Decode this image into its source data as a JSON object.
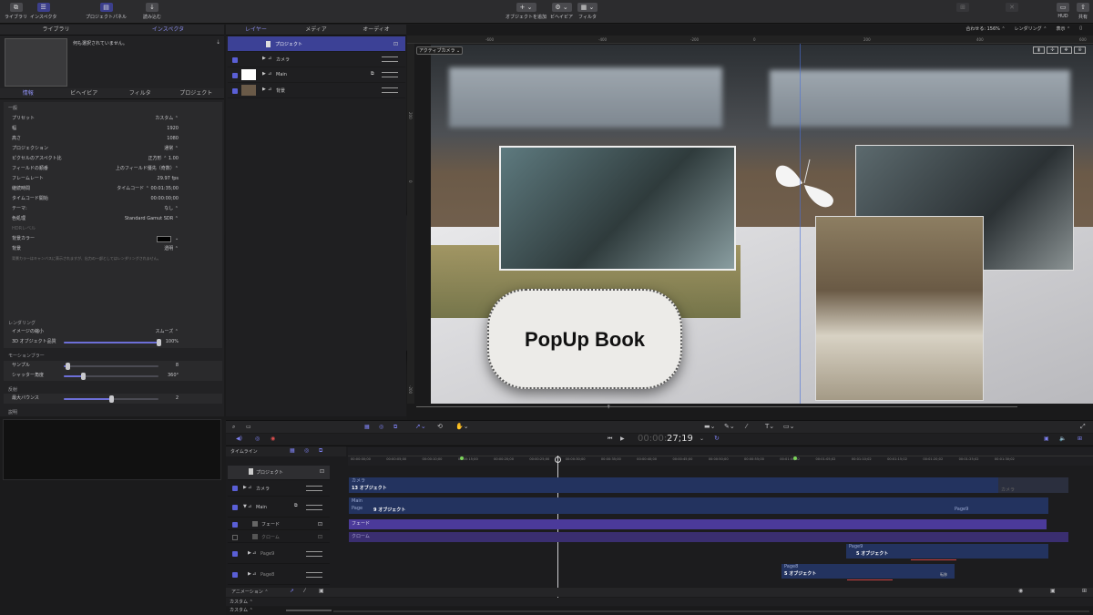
{
  "toolbar": {
    "library": "ライブラリ",
    "inspector": "インスペクタ",
    "project_panel": "プロジェクトパネル",
    "import": "読み込む",
    "add_object": "オブジェクトを追加",
    "behavior": "ビヘイビア",
    "filter": "フィルタ",
    "hud": "HUD",
    "share": "共有"
  },
  "left_tabs": [
    "ライブラリ",
    "インスペクタ"
  ],
  "preview_text": "何も選択されていません。",
  "inspector_tabs": [
    "情報",
    "ビヘイビア",
    "フィルタ",
    "プロジェクト"
  ],
  "general": {
    "section": "一般",
    "rows": [
      {
        "label": "プリセット",
        "value": "カスタム ⌃"
      },
      {
        "label": "幅",
        "value": "1920"
      },
      {
        "label": "高さ",
        "value": "1080"
      },
      {
        "label": "プロジェクション",
        "value": "通常 ⌃"
      },
      {
        "label": "ピクセルのアスペクト比",
        "value": "正方形 ⌃    1.00"
      },
      {
        "label": "フィールドの順番",
        "value": "上のフィールド優先（奇数）⌃"
      },
      {
        "label": "フレームレート",
        "value": "29.97 fps"
      },
      {
        "label": "継続時間",
        "value": "タイムコード ⌃  00:01:35;00"
      },
      {
        "label": "タイムコード開始",
        "value": "00:00:00;00"
      },
      {
        "label": "テーマ:",
        "value": "なし ⌃"
      },
      {
        "label": "色処理",
        "value": "Standard Gamut SDR ⌃"
      },
      {
        "label": "HDRレベル",
        "value": ""
      },
      {
        "label": "背景カラー",
        "value": ""
      },
      {
        "label": "背景",
        "value": "透明 ⌃"
      }
    ],
    "bg_note": "背景カラーはキャンバスに表示されますが、出力の一部としてはレンダリングされません。"
  },
  "rendering": {
    "section": "レンダリング",
    "rows": [
      {
        "label": "イメージの縮小",
        "value": "スムーズ ⌃"
      },
      {
        "label": "3D オブジェクト品質",
        "value": "100%",
        "level": 1.0
      }
    ]
  },
  "motion_blur": {
    "section": "モーションブラー",
    "rows": [
      {
        "label": "サンプル",
        "value": "8",
        "level": 0.04
      },
      {
        "label": "シャッター角度",
        "value": "360°",
        "level": 0.2
      }
    ]
  },
  "reflection": {
    "section": "反射",
    "rows": [
      {
        "label": "最大バウンス",
        "value": "2",
        "level": 0.5
      }
    ]
  },
  "description": {
    "section": "説明"
  },
  "layers_tabs": [
    "レイヤー",
    "メディア",
    "オーディオ"
  ],
  "layers": [
    {
      "name": "プロジェクト",
      "selected": true
    },
    {
      "name": "カメラ"
    },
    {
      "name": "Main"
    },
    {
      "name": "背景"
    }
  ],
  "canvas": {
    "zoom": "合わせる: 156% ⌃",
    "render_menu": "レンダリング ⌃",
    "view_menu": "表示 ⌃",
    "camera_menu": "アクティブカメラ ⌄",
    "ruler": [
      "-600",
      "-400",
      "-200",
      "0",
      "200",
      "400",
      "600"
    ],
    "vruler": [
      "200",
      "0",
      "-200"
    ],
    "title_card": "PopUp Book"
  },
  "transport": {
    "timecode": "27;19"
  },
  "timeline": {
    "label": "タイムライン",
    "ticks": [
      "00:00:00;00",
      "00:00:05;00",
      "00:00:10;00",
      "00:00:15;00",
      "00:00:20;00",
      "00:00:25;00",
      "00:00:30;00",
      "00:00:35;00",
      "00:00:40;00",
      "00:00:45;00",
      "00:00:50;00",
      "00:00:55;00",
      "00:01:00;02",
      "00:01:05;02",
      "00:01:10;02",
      "00:01:15;02",
      "00:01:20;02",
      "00:01:25;02",
      "00:01:30;02"
    ],
    "rows": [
      {
        "name": "プロジェクト"
      },
      {
        "name": "カメラ"
      },
      {
        "name": "Main"
      },
      {
        "name": "フェード"
      },
      {
        "name": "クローム"
      },
      {
        "name": "Page9"
      },
      {
        "name": "Page8"
      }
    ],
    "bars": {
      "camera_top": "カメラ",
      "camera_main": "13 オブジェクト",
      "camera_ghost": "カメラ",
      "main_top": "Main",
      "main_left": "Page",
      "main_main": "9 オブジェクト",
      "main_right": "Page9",
      "fade": "フェード",
      "chrome": "クローム",
      "page9_top": "Page9",
      "page9_main": "5 オブジェクト",
      "page8_top": "Page8",
      "page8_main": "5 オブジェクト",
      "page8_tag": "転移"
    },
    "animation_menu": "アニメーション ⌃",
    "custom_menu": "カスタム ⌃"
  },
  "colors": {
    "accent": "#5b5ee0",
    "purple_bar": "#4b3a9a",
    "blue_bar": "#23335f"
  }
}
